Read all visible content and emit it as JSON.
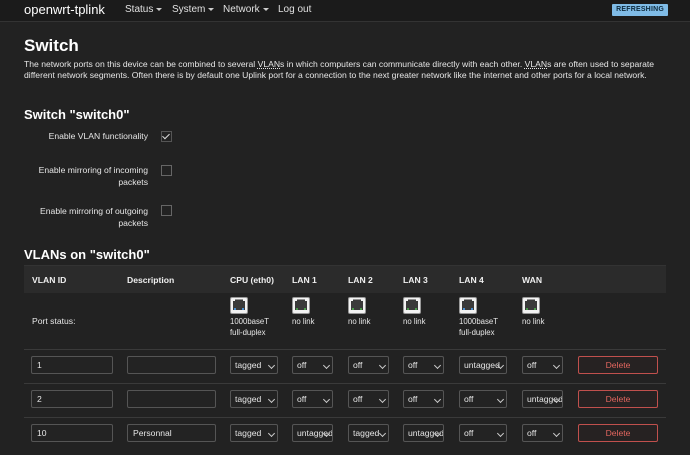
{
  "nav": {
    "brand": "openwrt-tplink",
    "items": [
      "Status",
      "System",
      "Network",
      "Log out"
    ],
    "badge": "REFRESHING"
  },
  "page": {
    "title": "Switch",
    "intro_1": "The network ports on this device can be combined to several ",
    "intro_vlans": "VLAN",
    "intro_2": "s in which computers can communicate directly with each other. ",
    "intro_3": "s are often used to separate different network segments. Often there is by default one Uplink port for a connection to the next greater network like the internet and other ports for a local network."
  },
  "switch": {
    "heading": "Switch \"switch0\"",
    "options": [
      {
        "label_lines": [
          "Enable VLAN functionality"
        ],
        "checked": true
      },
      {
        "label_lines": [
          "Enable mirroring of incoming",
          "packets"
        ],
        "checked": false
      },
      {
        "label_lines": [
          "Enable mirroring of outgoing",
          "packets"
        ],
        "checked": false
      }
    ]
  },
  "vlans": {
    "heading": "VLANs on \"switch0\"",
    "columns": [
      "VLAN ID",
      "Description",
      "CPU (eth0)",
      "LAN 1",
      "LAN 2",
      "LAN 3",
      "LAN 4",
      "WAN"
    ],
    "port_status_label": "Port status:",
    "port_status": [
      {
        "line1": "1000baseT",
        "line2": "full-duplex",
        "linked": true
      },
      {
        "line1": "no link",
        "line2": "",
        "linked": false
      },
      {
        "line1": "no link",
        "line2": "",
        "linked": false
      },
      {
        "line1": "no link",
        "line2": "",
        "linked": false
      },
      {
        "line1": "1000baseT",
        "line2": "full-duplex",
        "linked": true
      },
      {
        "line1": "no link",
        "line2": "",
        "linked": false
      }
    ],
    "rows": [
      {
        "id": "1",
        "description": "",
        "ports": [
          "tagged",
          "off",
          "off",
          "off",
          "untagged",
          "off"
        ]
      },
      {
        "id": "2",
        "description": "",
        "ports": [
          "tagged",
          "off",
          "off",
          "off",
          "off",
          "untagged"
        ]
      },
      {
        "id": "10",
        "description": "Personnal",
        "ports": [
          "tagged",
          "untagged",
          "tagged",
          "untagged",
          "off",
          "off"
        ]
      }
    ],
    "delete_label": "Delete"
  }
}
